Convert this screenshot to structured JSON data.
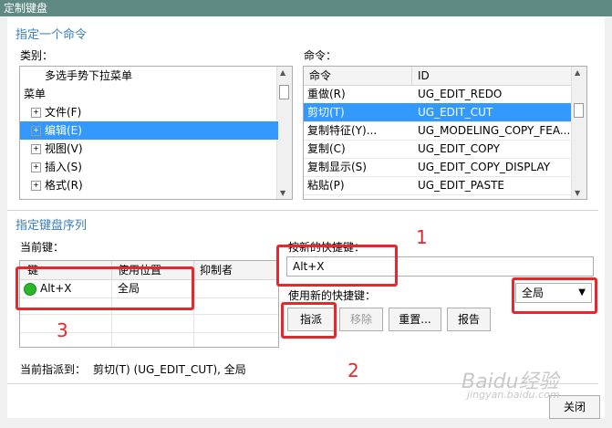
{
  "window": {
    "title": "定制键盘"
  },
  "specify_command": {
    "section_title": "指定一个命令",
    "category_label": "类别：",
    "categories": [
      {
        "label": "多选手势下拉菜单",
        "indent": 1
      },
      {
        "label": "菜单",
        "indent": 0
      },
      {
        "label": "文件(F)",
        "indent": 1,
        "expander": "+"
      },
      {
        "label": "编辑(E)",
        "indent": 1,
        "expander": "+",
        "selected": true
      },
      {
        "label": "视图(V)",
        "indent": 1,
        "expander": "+"
      },
      {
        "label": "插入(S)",
        "indent": 1,
        "expander": "+"
      },
      {
        "label": "格式(R)",
        "indent": 1,
        "expander": "+"
      }
    ],
    "command_label": "命令：",
    "command_columns": [
      "命令",
      "ID"
    ],
    "commands": [
      {
        "name": "重做(R)",
        "id": "UG_EDIT_REDO"
      },
      {
        "name": "剪切(T)",
        "id": "UG_EDIT_CUT",
        "selected": true
      },
      {
        "name": "复制特征(Y)...",
        "id": "UG_MODELING_COPY_FEA..."
      },
      {
        "name": "复制(C)",
        "id": "UG_EDIT_COPY"
      },
      {
        "name": "复制显示(S)",
        "id": "UG_EDIT_COPY_DISPLAY"
      },
      {
        "name": "粘贴(P)",
        "id": "UG_EDIT_PASTE"
      }
    ]
  },
  "key_sequence": {
    "section_title": "指定键盘序列",
    "current_keys_label": "当前键：",
    "columns": [
      "键",
      "使用位置",
      "抑制者"
    ],
    "rows": [
      {
        "key": "Alt+X",
        "location": "全局",
        "suppressor": ""
      }
    ],
    "new_shortcut_label": "按新的快捷键：",
    "new_shortcut_value": "Alt+X",
    "use_new_label": "使用新的快捷键：",
    "scope_value": "全局",
    "buttons": {
      "assign": "指派",
      "remove": "移除",
      "reset": "重置...",
      "report": "报告"
    },
    "current_assignment_label": "当前指派到：",
    "current_assignment_value": "剪切(T) (UG_EDIT_CUT), 全局"
  },
  "footer": {
    "close": "关闭"
  },
  "annotations": {
    "n1": "1",
    "n2": "2",
    "n3": "3"
  },
  "watermark": {
    "text": "Baidu经验",
    "sub": "jingyan.baidu.com"
  },
  "colors": {
    "title_bar": "#5f8a84",
    "accent": "#3a7fb8",
    "selection": "#3399ff",
    "annotation": "#e8262b"
  }
}
